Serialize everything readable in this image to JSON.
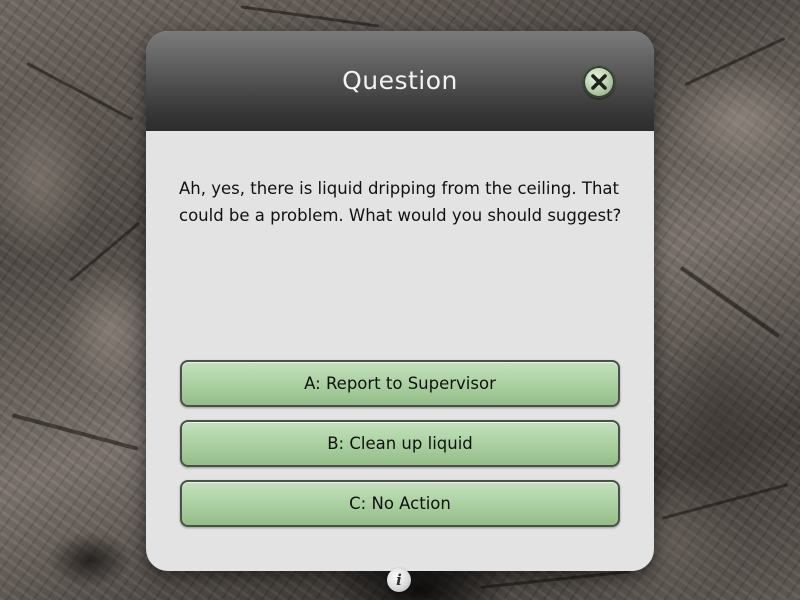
{
  "dialog": {
    "title": "Question",
    "close_icon": "close-x-icon",
    "question": "Ah, yes, there is liquid dripping from the ceiling. That could be a problem. What would you should suggest?",
    "answers": [
      {
        "label": "A: Report to Supervisor"
      },
      {
        "label": "B: Clean up liquid"
      },
      {
        "label": "C: No Action"
      }
    ]
  },
  "footer": {
    "info_label": "i",
    "info_icon": "info-icon"
  },
  "colors": {
    "header_dark": "#2c2c2c",
    "panel_bg": "#e3e3e3",
    "answer_green": "#a9cf9f",
    "answer_border": "#4a5147"
  }
}
